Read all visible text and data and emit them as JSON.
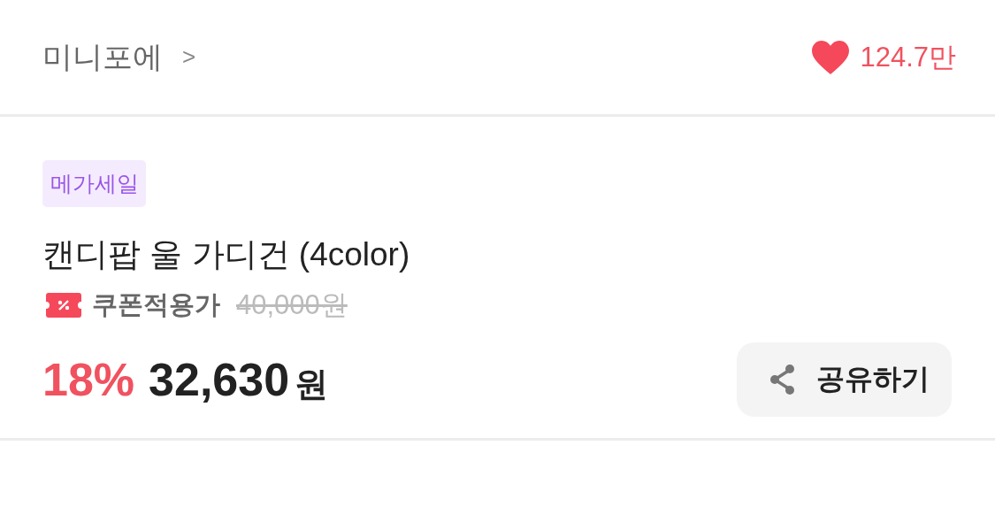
{
  "store": {
    "name": "미니포에",
    "chevron": ">"
  },
  "likes": {
    "count": "124.7만",
    "liked": true
  },
  "product": {
    "badge": "메가세일",
    "title": "캔디팝 울 가디건 (4color)",
    "coupon_label": "쿠폰적용가",
    "original_price": "40,000원",
    "discount": "18%",
    "price": "32,630",
    "currency": "원"
  },
  "share_button": {
    "label": "공유하기"
  }
}
